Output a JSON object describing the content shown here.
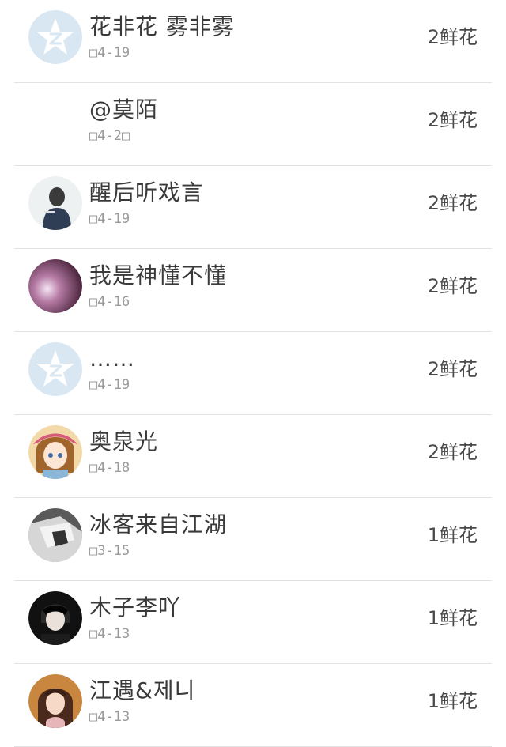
{
  "rows": [
    {
      "name": "花非花 雾非雾",
      "date": "□4-19",
      "flowers": "2鲜花",
      "avatar": "qq-default-icon"
    },
    {
      "name": "@莫陌",
      "date": "□4-2□",
      "flowers": "2鲜花",
      "avatar": "none"
    },
    {
      "name": "醒后听戏言",
      "date": "□4-19",
      "flowers": "2鲜花",
      "avatar": "person-back-photo"
    },
    {
      "name": "我是神懂不懂",
      "date": "□4-16",
      "flowers": "2鲜花",
      "avatar": "purple-glow-photo"
    },
    {
      "name": "……",
      "date": "□4-19",
      "flowers": "2鲜花",
      "avatar": "qq-default-icon"
    },
    {
      "name": "奥泉光",
      "date": "□4-18",
      "flowers": "2鲜花",
      "avatar": "anime-girl-photo"
    },
    {
      "name": "冰客来自江湖",
      "date": "□3-15",
      "flowers": "1鲜花",
      "avatar": "grayscale-photo"
    },
    {
      "name": "木子李吖",
      "date": "□4-13",
      "flowers": "1鲜花",
      "avatar": "dark-portrait-photo"
    },
    {
      "name": "江遇&제니",
      "date": "□4-13",
      "flowers": "1鲜花",
      "avatar": "girl-portrait-photo"
    }
  ],
  "colors": {
    "qq_default_bg": "#d9e7f3",
    "divider": "#e3e3e3",
    "name_text": "#3a3a3a",
    "date_text": "#9a9a9a"
  }
}
